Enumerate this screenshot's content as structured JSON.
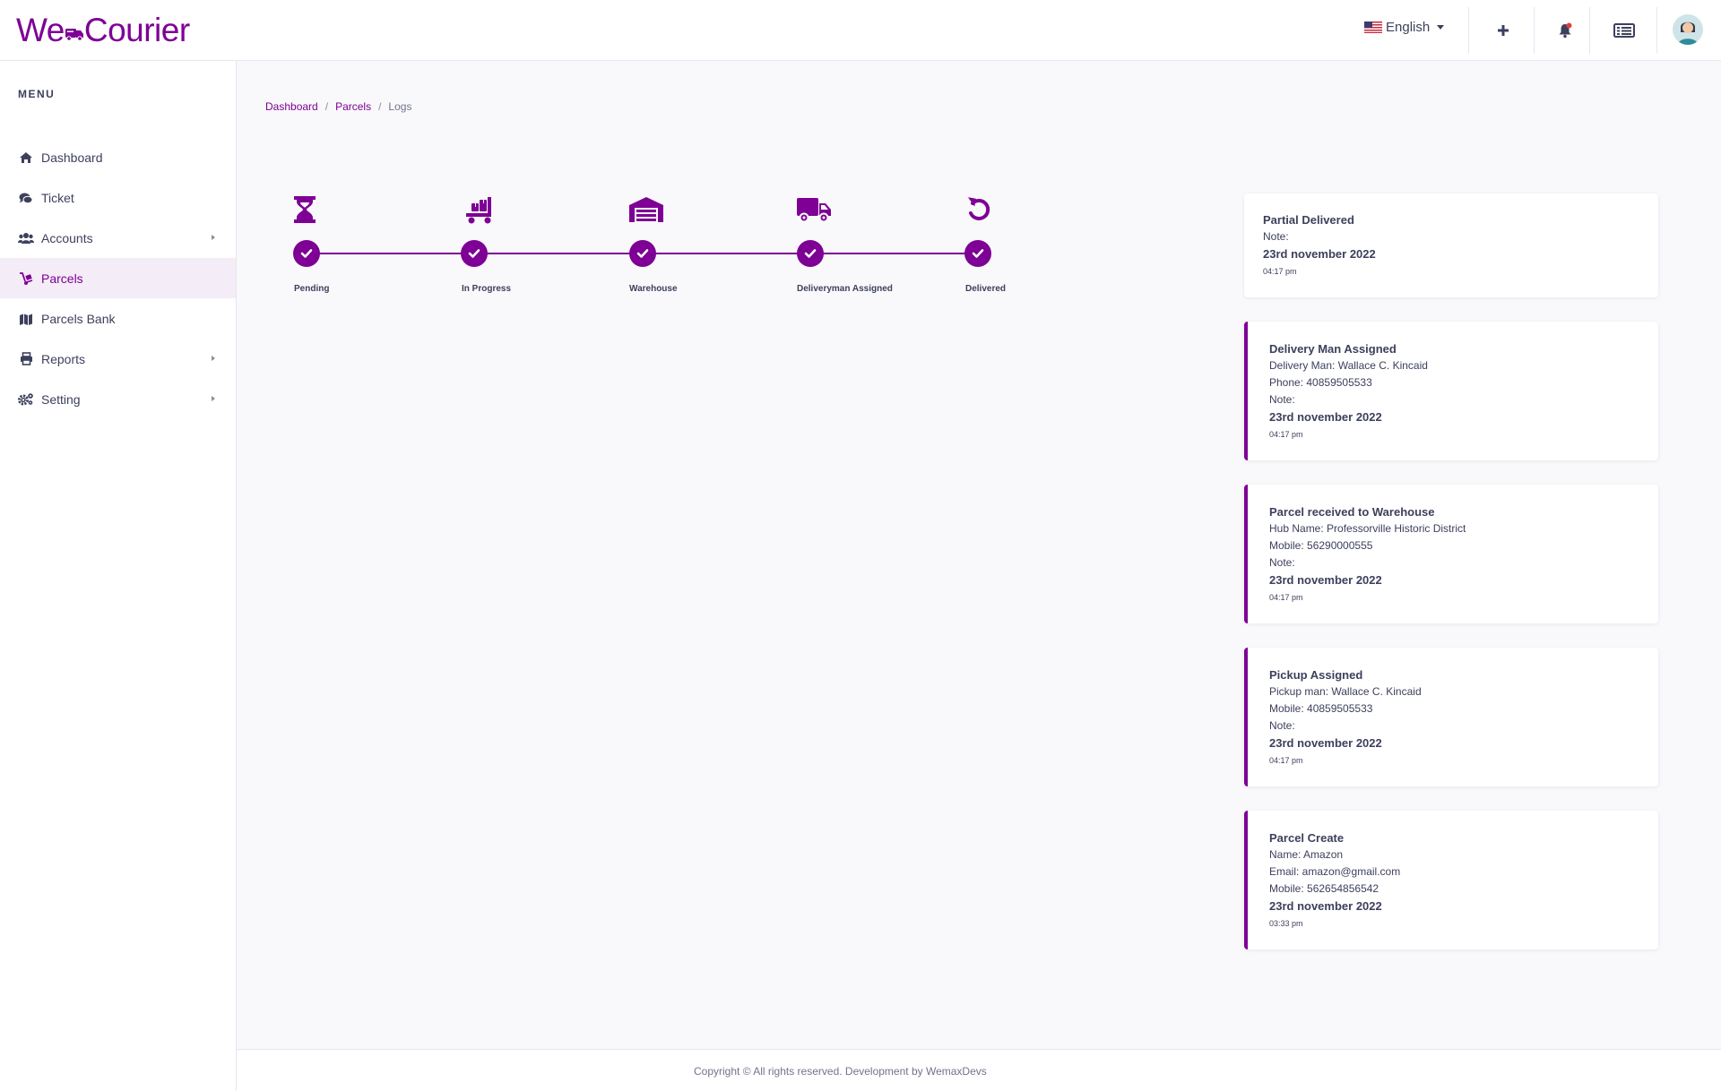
{
  "brand": {
    "logo_text_left": "We",
    "logo_text_right": "Courier",
    "accent_color": "#7e0095"
  },
  "header": {
    "language": "English",
    "language_flag_icon": "us-flag-icon",
    "icons": [
      "plus-icon",
      "bell-icon",
      "list-icon",
      "avatar"
    ]
  },
  "sidebar": {
    "menu_title": "MENU",
    "items": [
      {
        "label": "Dashboard",
        "icon": "home-icon",
        "has_submenu": false,
        "active": false
      },
      {
        "label": "Ticket",
        "icon": "comments-icon",
        "has_submenu": false,
        "active": false
      },
      {
        "label": "Accounts",
        "icon": "users-icon",
        "has_submenu": true,
        "active": false
      },
      {
        "label": "Parcels",
        "icon": "dolly-icon",
        "has_submenu": false,
        "active": true
      },
      {
        "label": "Parcels Bank",
        "icon": "map-icon",
        "has_submenu": false,
        "active": false
      },
      {
        "label": "Reports",
        "icon": "print-icon",
        "has_submenu": true,
        "active": false
      },
      {
        "label": "Setting",
        "icon": "cogs-icon",
        "has_submenu": true,
        "active": false
      }
    ]
  },
  "breadcrumb": {
    "items": [
      "Dashboard",
      "Parcels"
    ],
    "current": "Logs"
  },
  "tracker": {
    "steps": [
      {
        "label": "Pending",
        "icon": "hourglass-icon",
        "done": true
      },
      {
        "label": "In Progress",
        "icon": "dolly-flatbed-icon",
        "done": true
      },
      {
        "label": "Warehouse",
        "icon": "warehouse-icon",
        "done": true
      },
      {
        "label": "Deliveryman Assigned",
        "icon": "truck-icon",
        "done": true
      },
      {
        "label": "Delivered",
        "icon": "undo-icon",
        "done": true
      }
    ]
  },
  "logs": [
    {
      "title": "Partial Delivered",
      "lines": [
        "Note:"
      ],
      "date": "23rd november 2022",
      "time": "04:17 pm"
    },
    {
      "title": "Delivery Man Assigned",
      "lines": [
        "Delivery Man: Wallace C. Kincaid",
        "Phone: 40859505533",
        "Note:"
      ],
      "date": "23rd november 2022",
      "time": "04:17 pm"
    },
    {
      "title": "Parcel received to Warehouse",
      "lines": [
        "Hub Name: Professorville Historic District",
        "Mobile: 56290000555",
        "Note:"
      ],
      "date": "23rd november 2022",
      "time": "04:17 pm"
    },
    {
      "title": "Pickup Assigned",
      "lines": [
        "Pickup man: Wallace C. Kincaid",
        "Mobile: 40859505533",
        "Note:"
      ],
      "date": "23rd november 2022",
      "time": "04:17 pm"
    },
    {
      "title": "Parcel Create",
      "lines": [
        "Name: Amazon",
        "Email: amazon@gmail.com",
        "Mobile: 562654856542"
      ],
      "date": "23rd november 2022",
      "time": "03:33 pm"
    }
  ],
  "footer": {
    "text": "Copyright © All rights reserved. Development by WemaxDevs"
  }
}
